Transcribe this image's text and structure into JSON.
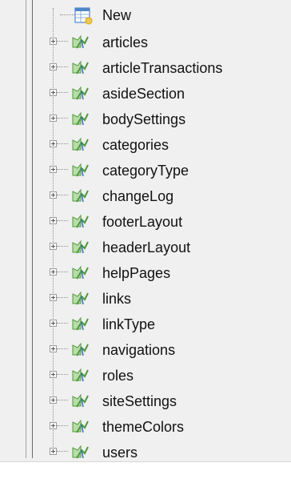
{
  "tree": {
    "new_label": "New",
    "items": [
      {
        "label": "articles"
      },
      {
        "label": "articleTransactions"
      },
      {
        "label": "asideSection"
      },
      {
        "label": "bodySettings"
      },
      {
        "label": "categories"
      },
      {
        "label": "categoryType"
      },
      {
        "label": "changeLog"
      },
      {
        "label": "footerLayout"
      },
      {
        "label": "headerLayout"
      },
      {
        "label": "helpPages"
      },
      {
        "label": "links"
      },
      {
        "label": "linkType"
      },
      {
        "label": "navigations"
      },
      {
        "label": "roles"
      },
      {
        "label": "siteSettings"
      },
      {
        "label": "themeColors"
      },
      {
        "label": "users"
      }
    ]
  },
  "icons": {
    "expander": "plus-box-icon",
    "table": "table-icon",
    "new": "new-table-icon"
  },
  "colors": {
    "panel_background": "#f0f0f0",
    "table_icon_green": "#4f9a3a",
    "table_icon_blue": "#2f6fc6"
  }
}
